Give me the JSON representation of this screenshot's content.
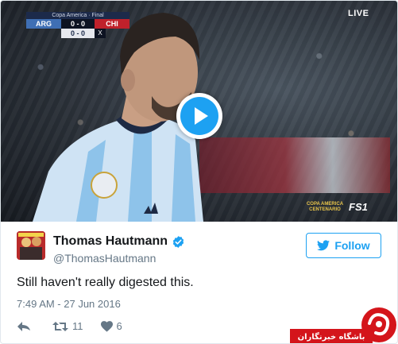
{
  "video": {
    "scoreboard": {
      "competition": "Copa America · Final",
      "home_team": "ARG",
      "home_score": "0 - 0",
      "away_team": "CHI",
      "penalties": "0 - 0",
      "penalty_marker": "X"
    },
    "live_label": "LIVE",
    "broadcast_logo": "COPA AMERICA CENTENARIO",
    "channel_logo": "FS1",
    "play_icon": "play-icon"
  },
  "author": {
    "display_name": "Thomas Hautmann",
    "handle": "@ThomasHautmann",
    "verified": true
  },
  "follow_button": {
    "label": "Follow",
    "icon": "twitter-bird-icon"
  },
  "tweet": {
    "text": "Still haven't really digested this.",
    "timestamp": "7:49 AM - 27 Jun 2016"
  },
  "actions": {
    "reply_icon": "reply-icon",
    "retweet_icon": "retweet-icon",
    "retweet_count": "11",
    "like_icon": "heart-icon",
    "like_count": "6"
  },
  "watermark": {
    "text": "باشگاه خبرنگاران"
  },
  "colors": {
    "twitter_blue": "#1da1f2",
    "text_primary": "#14171a",
    "text_secondary": "#657786",
    "watermark_red": "#d4151b"
  }
}
